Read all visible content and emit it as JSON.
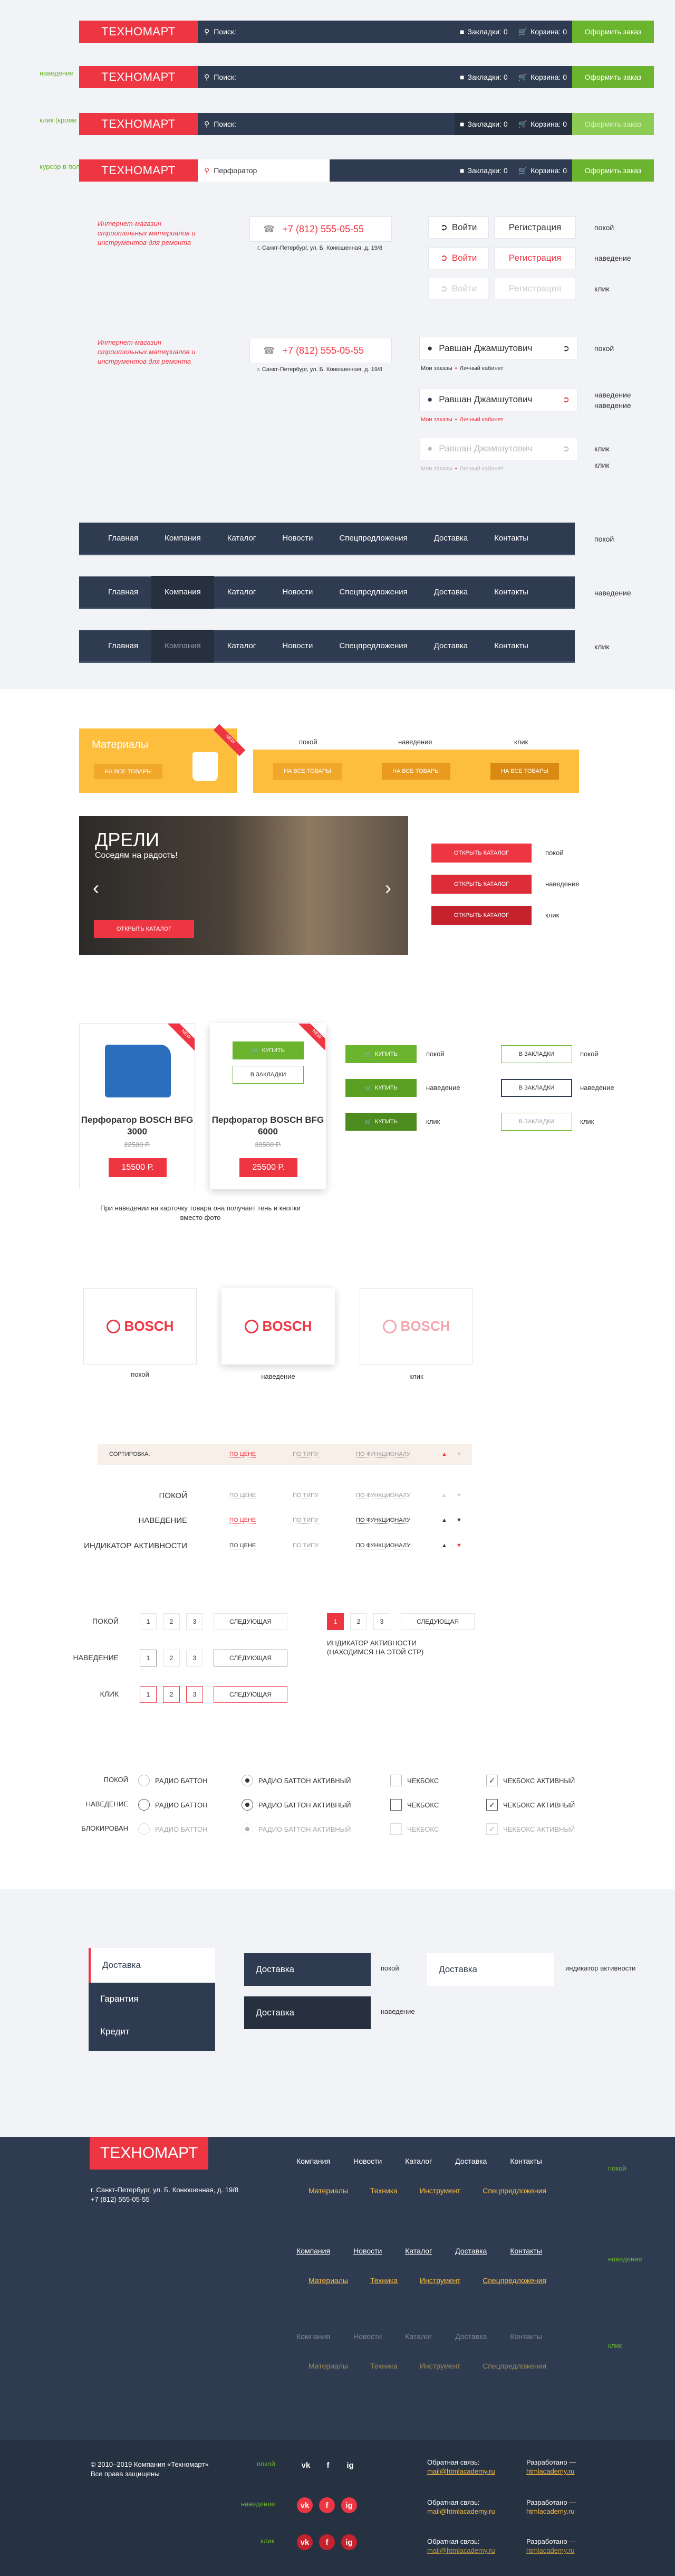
{
  "header": {
    "logo": "ТЕХНОМАРТ",
    "search_placeholder": "Поиск:",
    "search_active": "Перфоратор",
    "bookmarks": "Закладки: 0",
    "cart": "Корзина: 0",
    "order": "Оформить заказ",
    "states": [
      "наведение",
      "клик (кроме поиска)",
      "курсор в поле поиска"
    ]
  },
  "contact": {
    "tagline": "Интернет-магазин строительных материалов и инструментов для ремонта",
    "phone": "+7 (812) 555-05-55",
    "address": "г. Санкт-Петербург, ул. Б. Конюшенная, д. 19/8",
    "login": "Войти",
    "register": "Регистрация",
    "states": [
      "покой",
      "наведение",
      "клик"
    ]
  },
  "user": {
    "name": "Равшан Джамшутович",
    "orders": "Мои заказы",
    "cabinet": "Личный кабинет",
    "states": [
      "покой",
      "наведение",
      "наведение",
      "клик",
      "клик"
    ]
  },
  "nav": {
    "items": [
      "Главная",
      "Компания",
      "Каталог",
      "Новости",
      "Спецпредложения",
      "Доставка",
      "Контакты"
    ],
    "states": [
      "покой",
      "наведение",
      "клик"
    ]
  },
  "materials": {
    "title": "Материалы",
    "btn": "НА ВСЕ ТОВАРЫ",
    "ribbon": "NEW",
    "state_labels": [
      "покой",
      "наведение",
      "клик"
    ]
  },
  "slider": {
    "title": "ДРЕЛИ",
    "subtitle": "Соседям на радость!",
    "btn": "ОТКРЫТЬ КАТАЛОГ",
    "states": [
      "покой",
      "наведение",
      "клик"
    ]
  },
  "products": {
    "ribbon": "NEW",
    "items": [
      {
        "name": "Перфоратор BOSCH BFG 3000",
        "old": "22500 Р.",
        "price": "15500 Р."
      },
      {
        "name": "Перфоратор BOSCH BFG 6000",
        "old": "30500 Р.",
        "price": "25500 Р."
      }
    ],
    "buy": "КУПИТЬ",
    "bookmark": "В ЗАКЛАДКИ",
    "btn_states": [
      "покой",
      "наведение",
      "клик"
    ],
    "note": "При наведении на карточку товара она получает тень и кнопки вместо фото"
  },
  "brands": {
    "name": "BOSCH",
    "states": [
      "покой",
      "наведение",
      "клик"
    ]
  },
  "sort": {
    "title": "СОРТИРОВКА:",
    "price": "ПО ЦЕНЕ",
    "type": "ПО ТИПУ",
    "func": "ПО ФУНКЦИОНАЛУ",
    "states": [
      "ПОКОЙ",
      "НАВЕДЕНИЕ",
      "ИНДИКАТОР АКТИВНОСТИ"
    ]
  },
  "pagination": {
    "pages": [
      "1",
      "2",
      "3"
    ],
    "next": "СЛЕДУЮЩАЯ",
    "states": [
      "ПОКОЙ",
      "НАВЕДЕНИЕ",
      "КЛИК"
    ],
    "active_note": "ИНДИКАТОР АКТИВНОСТИ (НАХОДИМСЯ НА ЭТОЙ СТР)"
  },
  "form": {
    "radio": "РАДИО БАТТОН",
    "radio_active": "РАДИО БАТТОН АКТИВНЫЙ",
    "checkbox": "ЧЕКБОКС",
    "checkbox_active": "ЧЕКБОКС АКТИВНЫЙ",
    "states": [
      "ПОКОЙ",
      "НАВЕДЕНИЕ",
      "БЛОКИРОВАН"
    ]
  },
  "tabs": {
    "items": [
      "Доставка",
      "Гарантия",
      "Кредит"
    ],
    "state_calm": "покой",
    "state_active": "индикатор активности",
    "state_hover": "наведение"
  },
  "footer": {
    "logo": "ТЕХНОМАРТ",
    "address": "г. Санкт-Петербург, ул. Б. Конюшенная, д. 19/8",
    "phone": "+7 (812) 555-05-55",
    "nav": [
      "Компания",
      "Новости",
      "Каталог",
      "Доставка",
      "Контакты"
    ],
    "nav2": [
      "Материалы",
      "Техника",
      "Инструмент",
      "Спецпредложения"
    ],
    "states": [
      "покой",
      "наведение",
      "клик"
    ],
    "copyright": "© 2010–2019 Компания «Техномарт» Все права защищены",
    "feedback": "Обратная связь:",
    "mail": "mail@htmlacademy.ru",
    "dev": "Разработано —",
    "dev_link": "htmlacademy.ru",
    "social": [
      "vk",
      "f",
      "ig"
    ],
    "bottom_states": [
      "покой",
      "наведение",
      "клик"
    ]
  }
}
